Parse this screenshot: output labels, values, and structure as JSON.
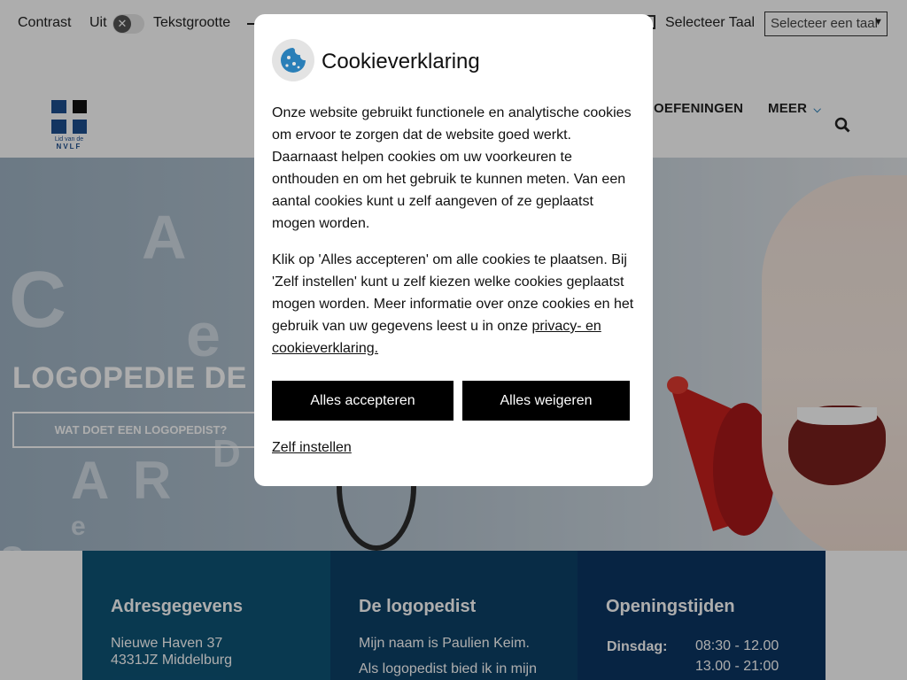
{
  "topbar": {
    "contrast_label": "Contrast",
    "contrast_value": "Uit",
    "text_size_label": "Tekstgrootte",
    "language_label": "Selecteer Taal",
    "language_select_value": "Selecteer een taal"
  },
  "logo": {
    "caption_line1": "Lid van de",
    "caption_line2": "NVLF"
  },
  "nav": {
    "items": [
      "OEFENINGEN",
      "MEER"
    ]
  },
  "hero": {
    "title": "LOGOPEDIE DE D",
    "button_label": "WAT DOET EEN LOGOPEDIST?"
  },
  "info": {
    "address": {
      "title": "Adresgegevens",
      "line1": "Nieuwe Haven 37",
      "line2": "4331JZ Middelburg"
    },
    "therapist": {
      "title": "De logopedist",
      "line1": "Mijn naam is Paulien Keim.",
      "line2": "Als logopedist bied ik in mijn"
    },
    "hours": {
      "title": "Openingstijden",
      "day": "Dinsdag:",
      "time1": "08:30 - 12.00",
      "time2": "13.00 - 21:00"
    }
  },
  "cookie_modal": {
    "title": "Cookieverklaring",
    "paragraph1": "Onze website gebruikt functionele en analytische cookies om ervoor te zorgen dat de website goed werkt. Daarnaast helpen cookies om uw voorkeuren te onthouden en om het gebruik te kunnen meten. Van een aantal cookies kunt u zelf aangeven of ze geplaatst mogen worden.",
    "paragraph2_text": "Klik op 'Alles accepteren' om alle cookies te plaatsen. Bij 'Zelf instellen' kunt u zelf kiezen welke cookies geplaatst mogen worden. Meer informatie over onze cookies en het gebruik van uw gegevens leest u in onze ",
    "privacy_link": "privacy- en cookieverklaring.",
    "accept_all": "Alles accepteren",
    "reject_all": "Alles weigeren",
    "self_configure": "Zelf instellen"
  },
  "colors": {
    "modal_button": "#000000",
    "info_col1": "#0e5477",
    "info_col2": "#0d4167",
    "info_col3": "#0b3563",
    "cookie_icon": "#2a7fb8"
  }
}
